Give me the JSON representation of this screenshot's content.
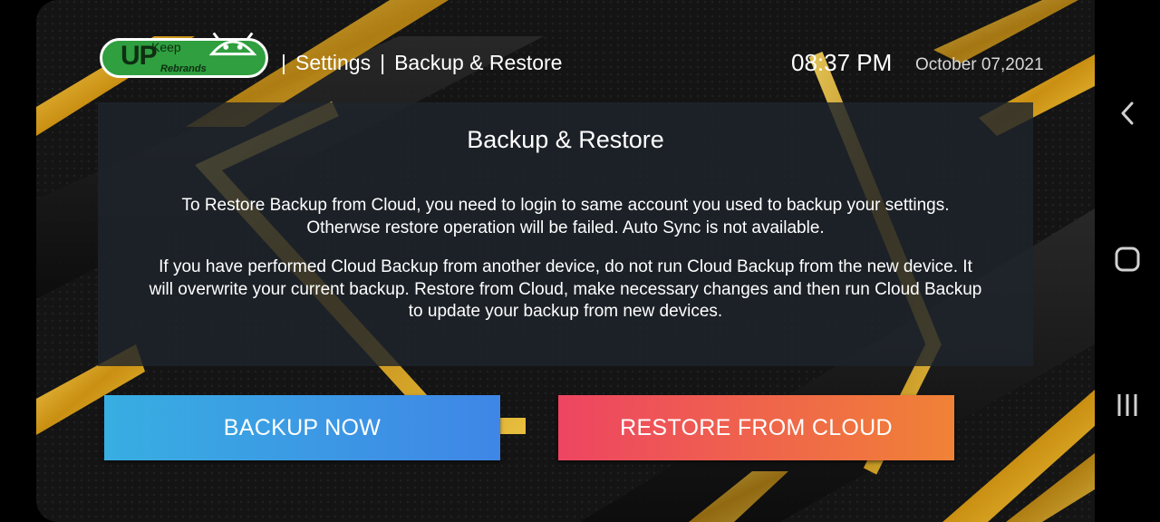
{
  "header": {
    "logo": {
      "brand_small": "Keep",
      "brand_big": "UP",
      "tagline": "Rebrands",
      "icon": "android-antenna-icon"
    },
    "separator": "|",
    "breadcrumb": [
      "Settings",
      "Backup & Restore"
    ],
    "time": "08:37 PM",
    "date": "October 07,2021"
  },
  "panel": {
    "title": "Backup & Restore",
    "paragraph1_line1": "To Restore Backup from Cloud, you need to login to same account you used to backup your settings.",
    "paragraph1_line2": "Otherwse restore operation will be failed. Auto Sync is not available.",
    "paragraph2_line1": "If you have performed Cloud Backup from another device, do not run Cloud Backup from the new device. It",
    "paragraph2_line2": "will overwrite your current backup. Restore from Cloud, make necessary changes and then run Cloud Backup",
    "paragraph2_line3": "to update your backup from new devices."
  },
  "buttons": {
    "backup_label": "BACKUP NOW",
    "restore_label": "RESTORE FROM CLOUD"
  },
  "colors": {
    "backup_gradient": [
      "#38aee2",
      "#3f86e6"
    ],
    "restore_gradient": [
      "#ee4562",
      "#f08236"
    ],
    "gold_accent": "#e7b423",
    "logo_green": "#2f9f3f"
  },
  "navbar": {
    "back_icon": "chevron-left-icon",
    "home_icon": "home-square-icon",
    "recents_icon": "recents-bars-icon"
  }
}
